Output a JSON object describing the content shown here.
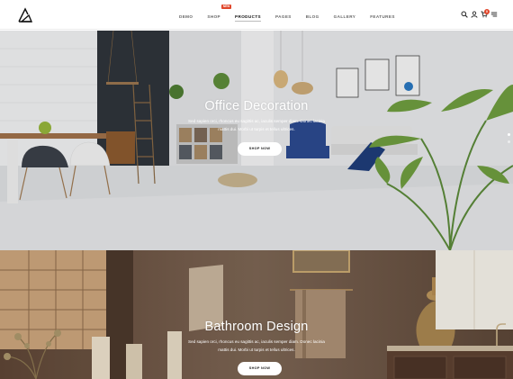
{
  "header": {
    "nav": [
      {
        "label": "DEMO"
      },
      {
        "label": "SHOP"
      },
      {
        "label": "PRODUCTS"
      },
      {
        "label": "PAGES"
      },
      {
        "label": "BLOG"
      },
      {
        "label": "GALLERY"
      },
      {
        "label": "FEATURES"
      }
    ],
    "badge": "NEW",
    "cart_count": "0",
    "icons": [
      "search-icon",
      "user-icon",
      "cart-icon",
      "menu-icon"
    ]
  },
  "hero1": {
    "title": "Office Decoration",
    "text_line1": "Sed sapien orci, rhoncus eu sagittis ac, iaculis semper diam. Donec lacinia",
    "text_line2": "mattis dui. Morbi ut turpis et tellus ultrices.",
    "button": "SHOP NOW"
  },
  "hero2": {
    "title": "Bathroom Design",
    "text_line1": "Sed sapien orci, rhoncus eu sagittis ac, iaculis semper diam. Donec lacinia",
    "text_line2": "mattis dui. Morbi ut turpis et tellus ultrices.",
    "button": "SHOP NOW"
  },
  "colors": {
    "accent": "#e0452a",
    "wall_light": "#e8e9eb",
    "wall_dark": "#2e3338",
    "bath_brown": "#6b5545"
  }
}
